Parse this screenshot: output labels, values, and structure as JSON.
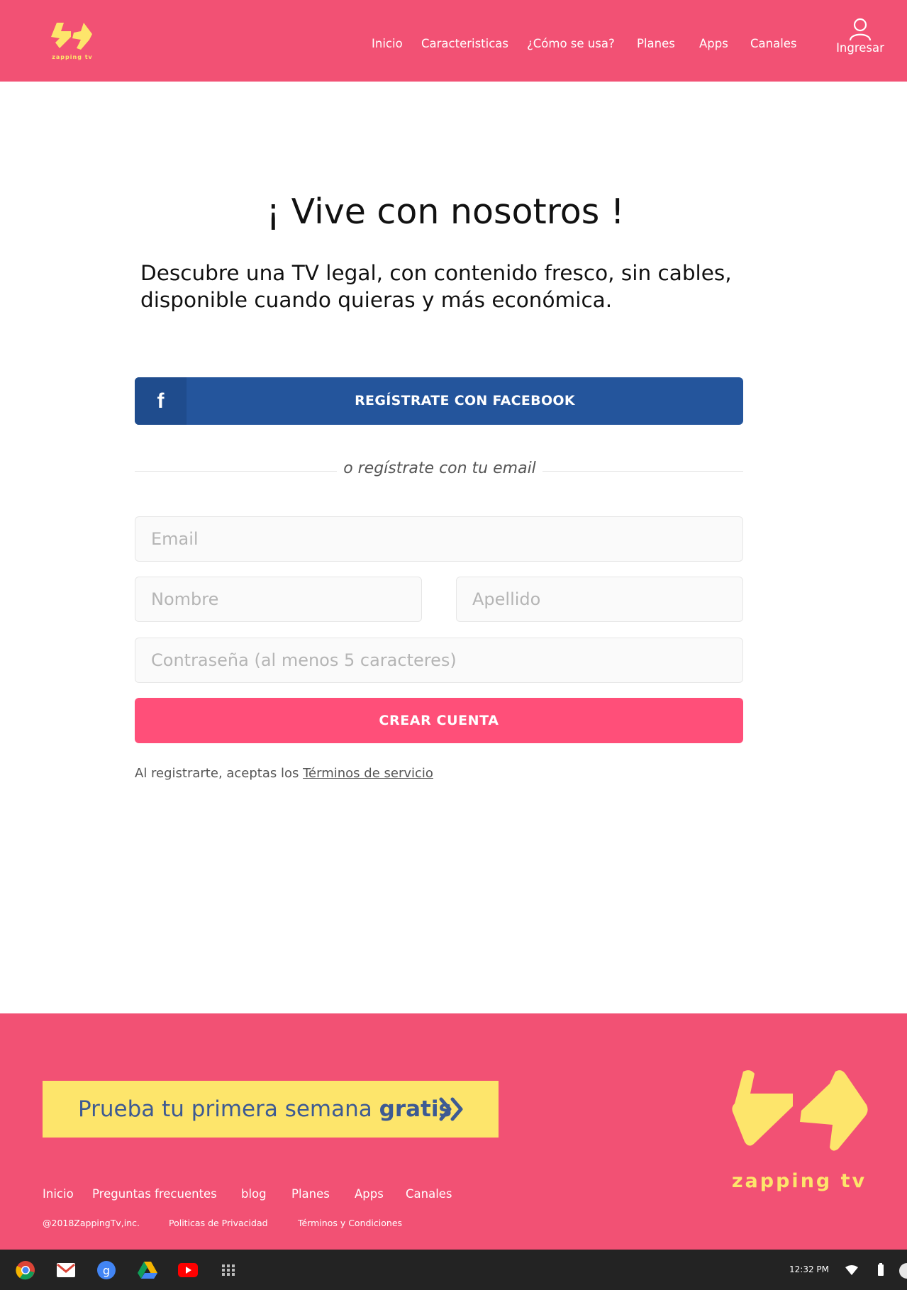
{
  "brand": {
    "name": "zapping tv",
    "logo_color": "#fde56b",
    "primary": "#f25174"
  },
  "nav": {
    "items": [
      "Inicio",
      "Caracteristicas",
      "¿Cómo se usa?",
      "Planes",
      "Apps",
      "Canales"
    ],
    "login_label": "Ingresar",
    "login_icon": "user-icon"
  },
  "hero": {
    "title": "¡ Vive con nosotros !",
    "subtitle": "Descubre una TV legal, con contenido fresco, sin cables, disponible cuando quieras y más económica."
  },
  "signup": {
    "facebook_label": "REGÍSTRATE CON FACEBOOK",
    "facebook_icon": "facebook-icon",
    "facebook_color": "#24559c",
    "divider_text": "o regístrate con tu email",
    "email_placeholder": "Email",
    "first_name_placeholder": "Nombre",
    "last_name_placeholder": "Apellido",
    "password_placeholder": "Contraseña (al menos 5 caracteres)",
    "submit_label": "CREAR CUENTA",
    "submit_color": "#ff4f79",
    "terms_prefix": "Al registrarte, aceptas los",
    "terms_link": "Términos de servicio"
  },
  "footer": {
    "cta_text": "Prueba tu primera semana",
    "cta_bold": "gratis",
    "cta_color": "#fde56b",
    "links": [
      "Inicio",
      "Preguntas  frecuentes",
      "blog",
      "Planes",
      "Apps",
      "Canales"
    ],
    "copyright": "@2018ZappingTv,inc.",
    "privacy": "Politicas de Privacidad",
    "terms": "Términos y Condiciones",
    "brand_name": "zapping tv"
  },
  "taskbar": {
    "apps": [
      "chrome-icon",
      "gmail-icon",
      "google-icon",
      "drive-icon",
      "youtube-icon",
      "launcher-icon"
    ],
    "time": "12:32 PM",
    "status_icons": [
      "wifi-icon",
      "battery-icon"
    ]
  }
}
